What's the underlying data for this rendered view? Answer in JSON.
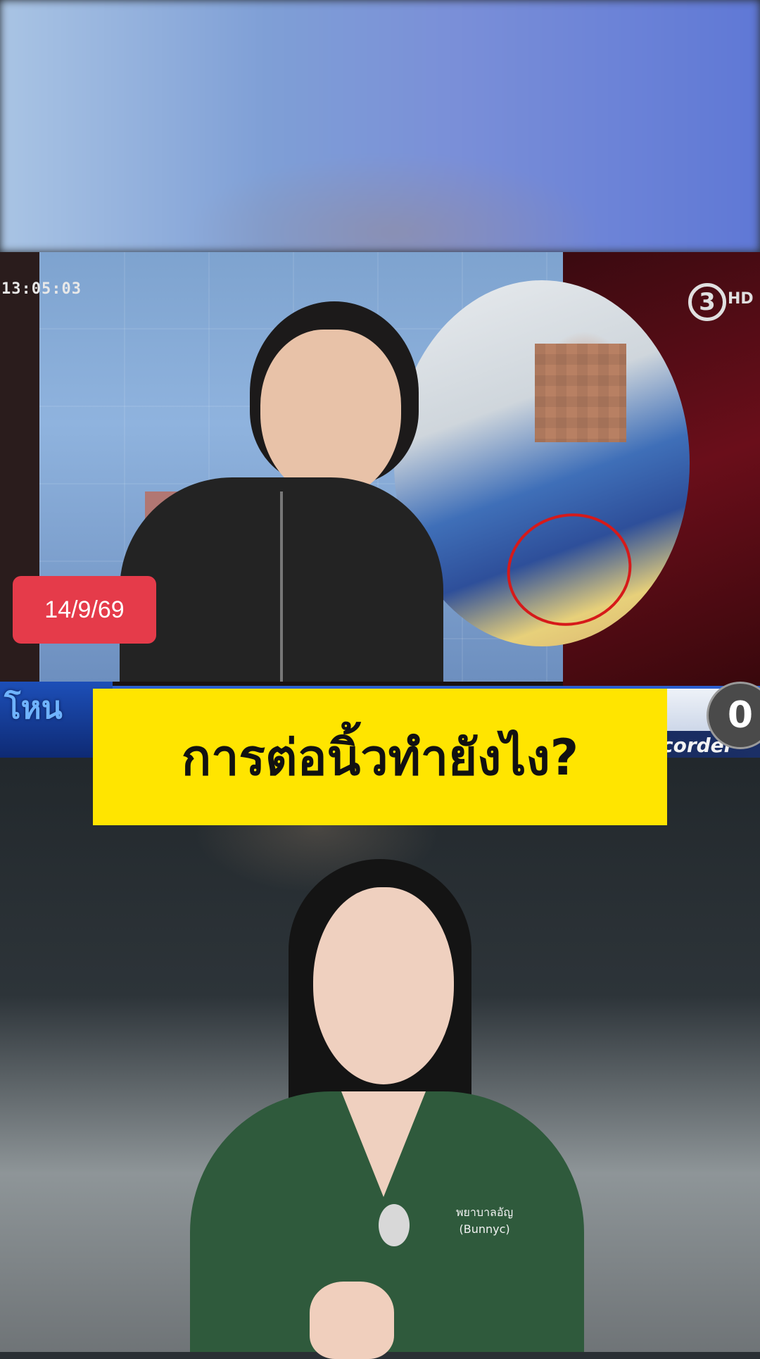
{
  "video": {
    "clip": {
      "timestamp": "13:05:03",
      "date_badge": "14/9/69",
      "channel_logo": "3",
      "channel_hd": "HD",
      "program_logo": "โหน",
      "lower_third_source": "corder",
      "play_button_glyph": "0"
    },
    "caption": "การต่อนิ้วทำยังไง?",
    "presenter": {
      "badge_line1": "พยาบาลอัญ",
      "badge_line2": "(Bunnyc)"
    }
  },
  "colors": {
    "caption_bg": "#ffe500",
    "date_badge_bg": "#e53b4a",
    "scrub_green": "#2f5a3c"
  }
}
